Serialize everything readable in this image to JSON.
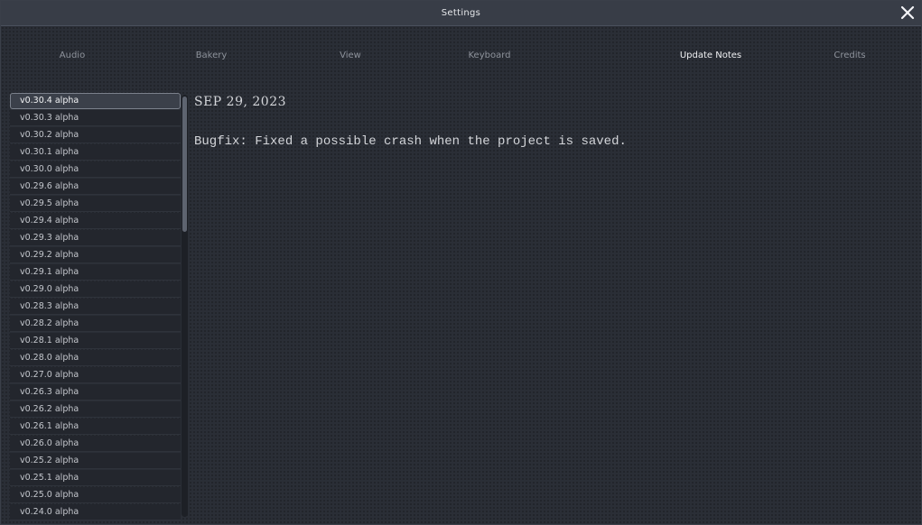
{
  "window": {
    "title": "Settings"
  },
  "close_icon": "close-icon",
  "tabs": [
    {
      "label": "Audio",
      "active": false
    },
    {
      "label": "Bakery",
      "active": false
    },
    {
      "label": "View",
      "active": false
    },
    {
      "label": "Keyboard",
      "active": false
    },
    {
      "label": "Update Notes",
      "active": true
    },
    {
      "label": "Credits",
      "active": false
    }
  ],
  "versions": [
    "v0.30.4 alpha",
    "v0.30.3 alpha",
    "v0.30.2 alpha",
    "v0.30.1 alpha",
    "v0.30.0 alpha",
    "v0.29.6 alpha",
    "v0.29.5 alpha",
    "v0.29.4 alpha",
    "v0.29.3 alpha",
    "v0.29.2 alpha",
    "v0.29.1 alpha",
    "v0.29.0 alpha",
    "v0.28.3 alpha",
    "v0.28.2 alpha",
    "v0.28.1 alpha",
    "v0.28.0 alpha",
    "v0.27.0 alpha",
    "v0.26.3 alpha",
    "v0.26.2 alpha",
    "v0.26.1 alpha",
    "v0.26.0 alpha",
    "v0.25.2 alpha",
    "v0.25.1 alpha",
    "v0.25.0 alpha",
    "v0.24.0 alpha"
  ],
  "selected_version": "v0.30.4 alpha",
  "notes": {
    "date": "SEP 29, 2023",
    "body": "Bugfix: Fixed a possible crash when the project is saved."
  },
  "colors": {
    "background": "#2a2e36",
    "titlebar": "#383d47",
    "selected_item": "#3b404a",
    "text": "#d4d6da"
  }
}
